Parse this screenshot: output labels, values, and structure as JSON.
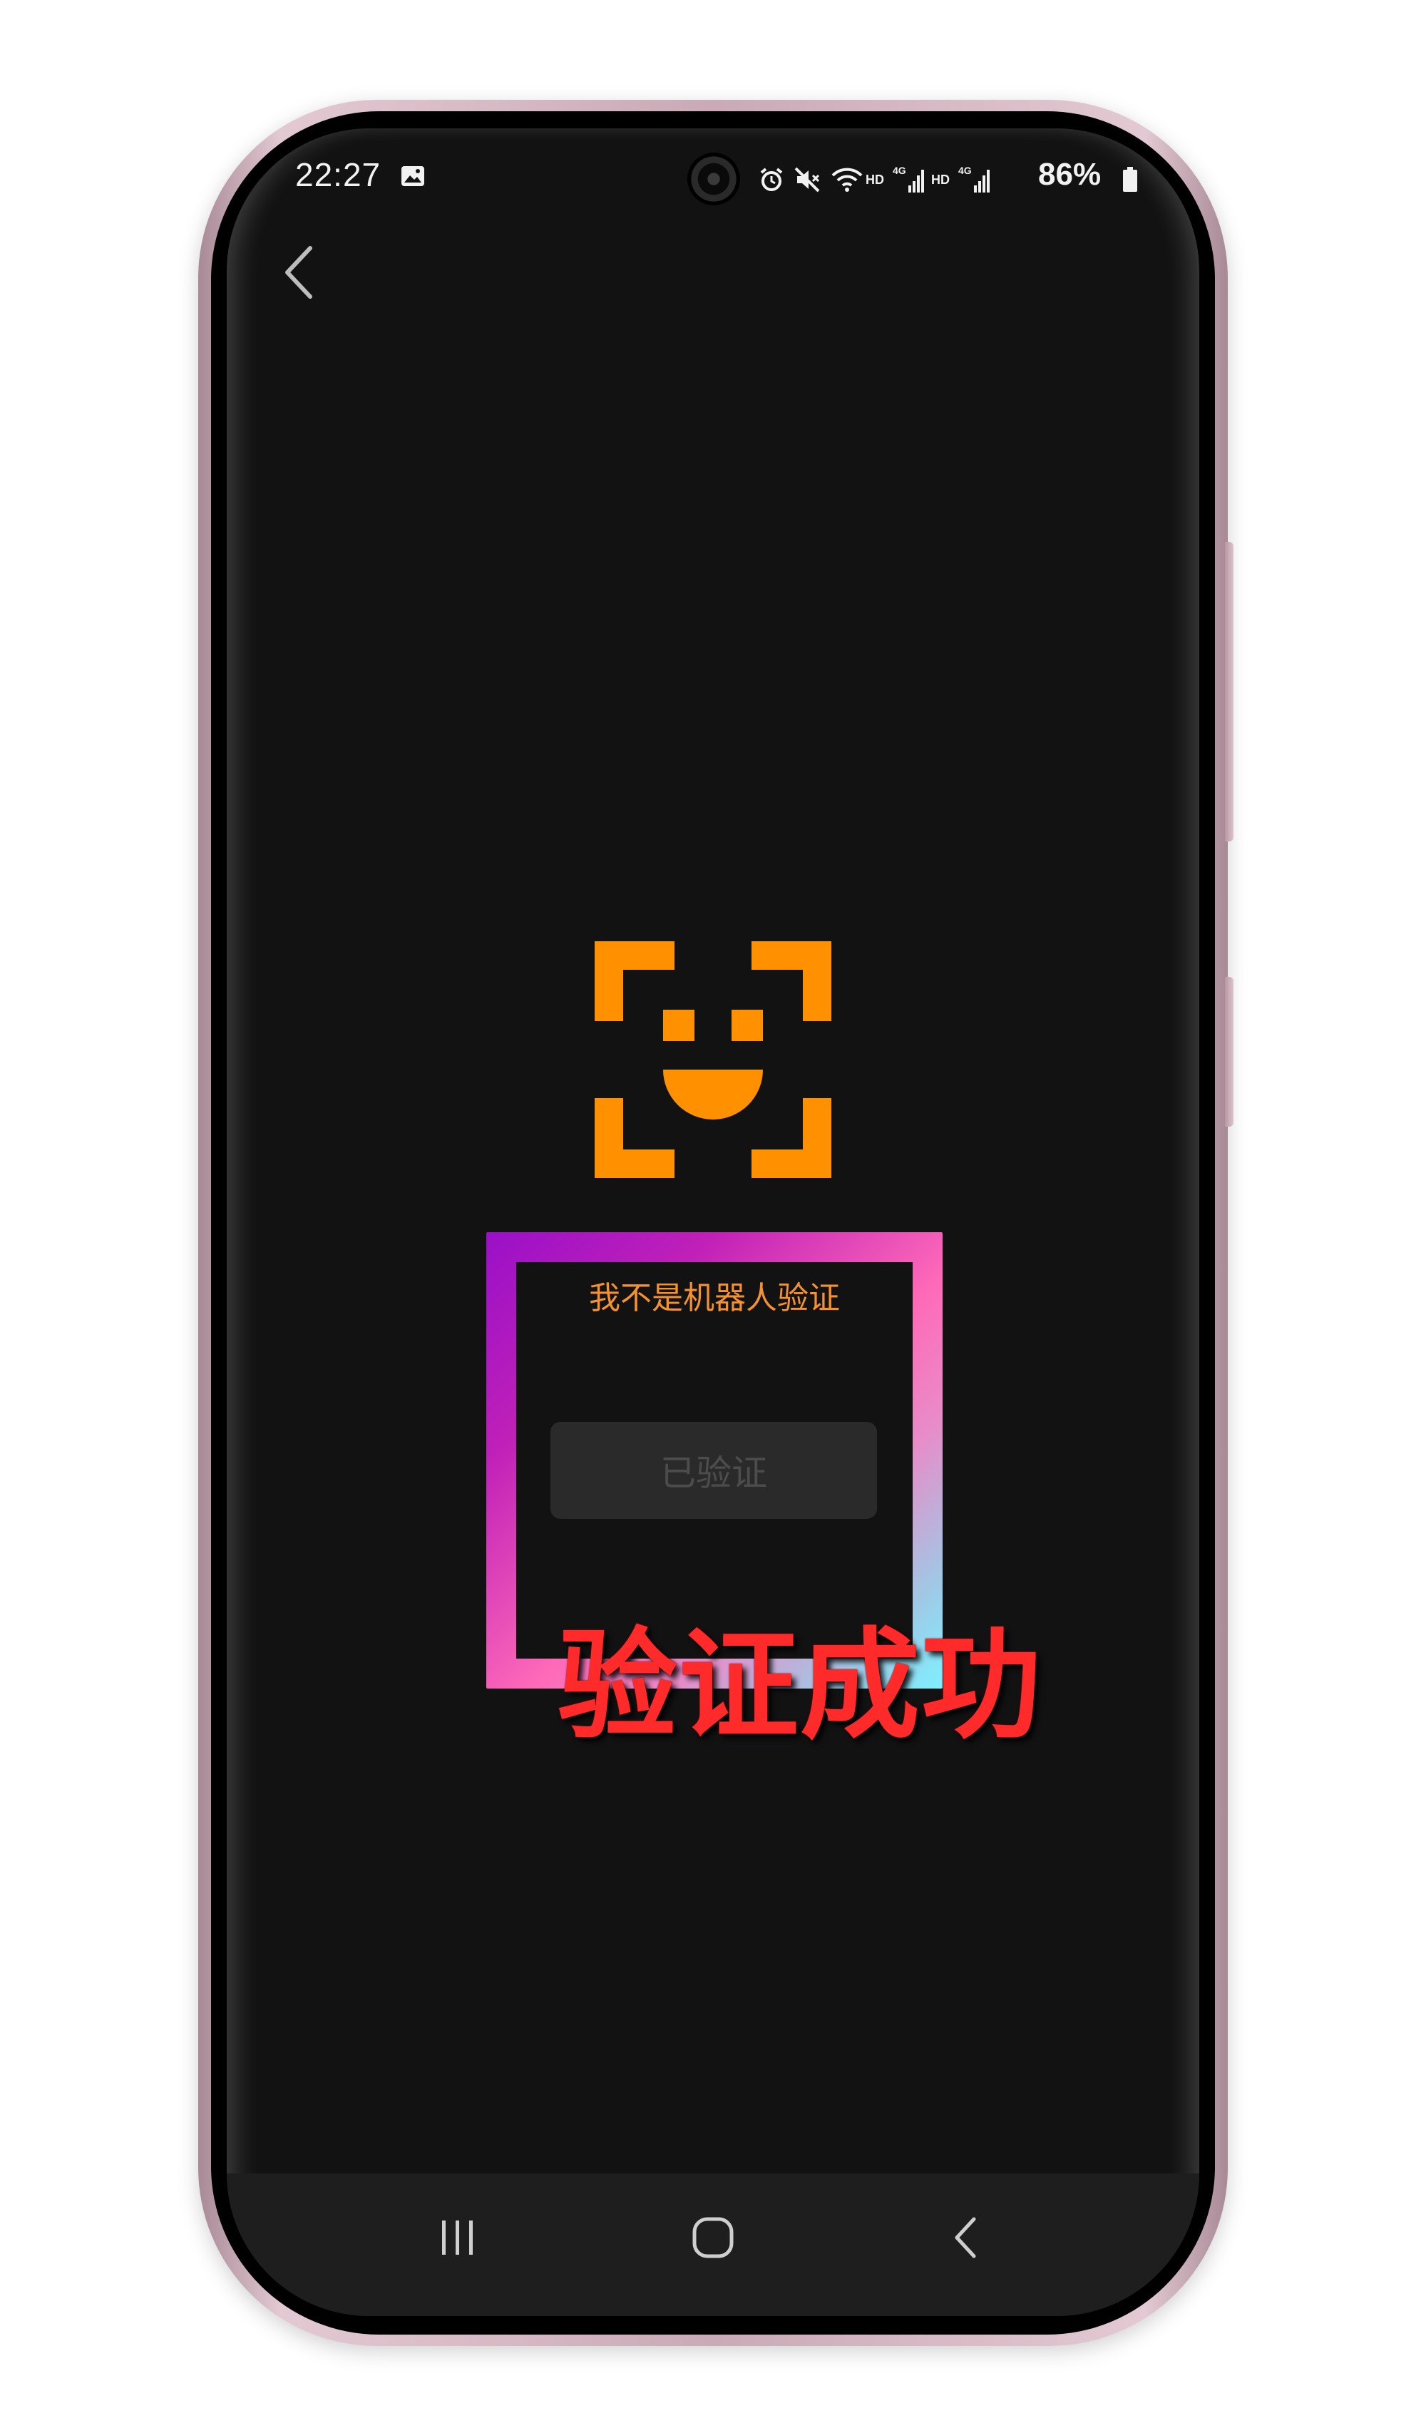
{
  "status_bar": {
    "time": "22:27",
    "battery_percent": "86%",
    "hd_label": "HD",
    "network_label": "4G",
    "icons": [
      "gallery-icon",
      "alarm-icon",
      "mute-icon",
      "wifi-icon",
      "signal-icon",
      "battery-icon"
    ]
  },
  "app": {
    "back_icon": "chevron-left-icon",
    "face_scan_icon": "face-scan-icon",
    "verify_title": "我不是机器人验证",
    "verified_button_label": "已验证",
    "success_text": "验证成功"
  },
  "nav_bar": {
    "recents_icon": "recents-icon",
    "home_icon": "home-icon",
    "back_icon": "back-icon"
  },
  "colors": {
    "screen_background": "#121212",
    "accent_orange": "#ff9100",
    "title_orange": "#f5922d",
    "success_red": "#ff2a2a",
    "button_bg": "#2a2a2a",
    "frame_gradient": [
      "#9a10c8",
      "#ff6ab8",
      "#7ff0ff"
    ]
  }
}
